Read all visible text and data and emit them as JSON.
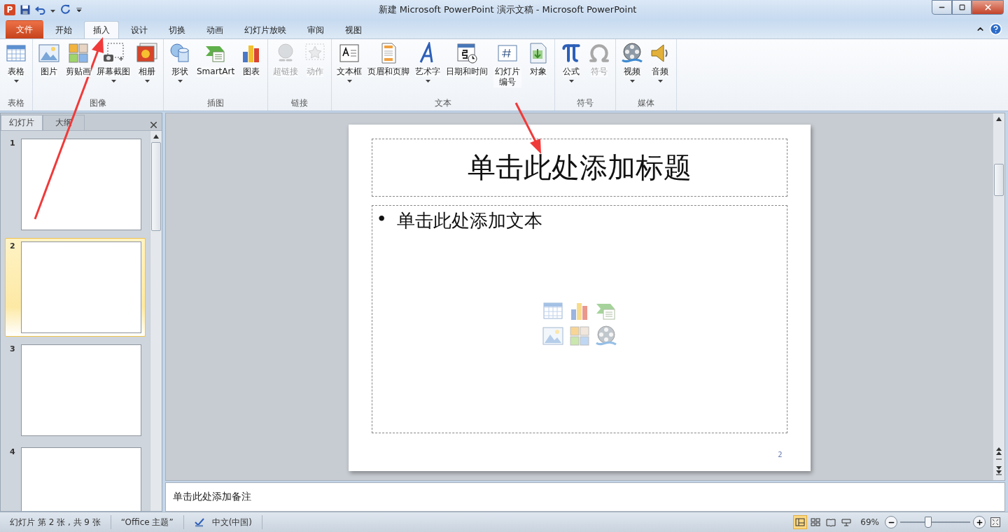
{
  "window": {
    "title": "新建 Microsoft PowerPoint 演示文稿 - Microsoft PowerPoint",
    "app_logo": "P"
  },
  "ribbon_tabs": [
    {
      "label": "文件",
      "kind": "file",
      "selected": false
    },
    {
      "label": "开始",
      "kind": "tab",
      "selected": false
    },
    {
      "label": "插入",
      "kind": "tab",
      "selected": true
    },
    {
      "label": "设计",
      "kind": "tab",
      "selected": false
    },
    {
      "label": "切换",
      "kind": "tab",
      "selected": false
    },
    {
      "label": "动画",
      "kind": "tab",
      "selected": false
    },
    {
      "label": "幻灯片放映",
      "kind": "tab",
      "selected": false
    },
    {
      "label": "审阅",
      "kind": "tab",
      "selected": false
    },
    {
      "label": "视图",
      "kind": "tab",
      "selected": false
    }
  ],
  "ribbon_groups": [
    {
      "label": "表格",
      "buttons": [
        {
          "label": "表格",
          "dropdown": true,
          "disabled": false
        }
      ]
    },
    {
      "label": "图像",
      "buttons": [
        {
          "label": "图片",
          "dropdown": false,
          "disabled": false
        },
        {
          "label": "剪贴画",
          "dropdown": false,
          "disabled": false
        },
        {
          "label": "屏幕截图",
          "dropdown": true,
          "disabled": false
        },
        {
          "label": "相册",
          "dropdown": true,
          "disabled": false
        }
      ]
    },
    {
      "label": "插图",
      "buttons": [
        {
          "label": "形状",
          "dropdown": true,
          "disabled": false
        },
        {
          "label": "SmartArt",
          "dropdown": false,
          "disabled": false
        },
        {
          "label": "图表",
          "dropdown": false,
          "disabled": false
        }
      ]
    },
    {
      "label": "链接",
      "buttons": [
        {
          "label": "超链接",
          "dropdown": false,
          "disabled": true
        },
        {
          "label": "动作",
          "dropdown": false,
          "disabled": true
        }
      ]
    },
    {
      "label": "文本",
      "buttons": [
        {
          "label": "文本框",
          "dropdown": true,
          "disabled": false
        },
        {
          "label": "页眉和页脚",
          "dropdown": false,
          "disabled": false
        },
        {
          "label": "艺术字",
          "dropdown": true,
          "disabled": false
        },
        {
          "label": "日期和时间",
          "dropdown": false,
          "disabled": false
        },
        {
          "label": "幻灯片编号",
          "dropdown": false,
          "disabled": false
        },
        {
          "label": "对象",
          "dropdown": false,
          "disabled": false
        }
      ]
    },
    {
      "label": "符号",
      "buttons": [
        {
          "label": "公式",
          "dropdown": true,
          "disabled": false
        },
        {
          "label": "符号",
          "dropdown": false,
          "disabled": true
        }
      ]
    },
    {
      "label": "媒体",
      "buttons": [
        {
          "label": "视频",
          "dropdown": true,
          "disabled": false
        },
        {
          "label": "音频",
          "dropdown": true,
          "disabled": false
        }
      ]
    }
  ],
  "pane_tabs": [
    {
      "label": "幻灯片",
      "selected": true
    },
    {
      "label": "大纲",
      "selected": false
    }
  ],
  "thumbnails": [
    {
      "number": "1",
      "selected": false
    },
    {
      "number": "2",
      "selected": true
    },
    {
      "number": "3",
      "selected": false
    },
    {
      "number": "4",
      "selected": false
    }
  ],
  "slide": {
    "title_placeholder": "单击此处添加标题",
    "bullet": "•",
    "body_placeholder": "单击此处添加文本",
    "page_number": "2"
  },
  "notes": {
    "placeholder": "单击此处添加备注"
  },
  "status_bar": {
    "slide_info": "幻灯片 第 2 张 , 共 9 张",
    "theme": "“Office 主题”",
    "language": "中文(中国)",
    "views": [
      {
        "selected": true
      },
      {
        "selected": false
      },
      {
        "selected": false
      },
      {
        "selected": false
      }
    ],
    "zoom": "69%",
    "zoom_level": {
      "level": 0.4
    }
  }
}
